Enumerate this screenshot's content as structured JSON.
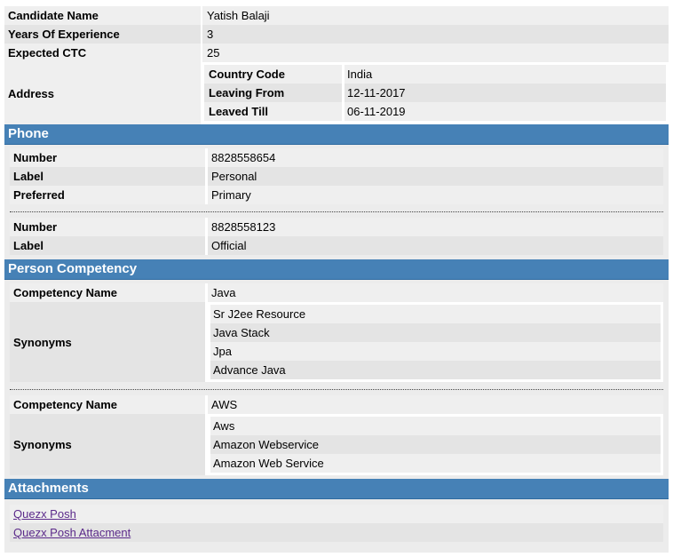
{
  "candidate": {
    "name_label": "Candidate Name",
    "name_value": "Yatish Balaji",
    "exp_label": "Years Of Experience",
    "exp_value": "3",
    "ctc_label": "Expected CTC",
    "ctc_value": "25",
    "address_label": "Address",
    "address": [
      {
        "label": "Country Code",
        "value": "India"
      },
      {
        "label": "Leaving From",
        "value": "12-11-2017"
      },
      {
        "label": "Leaved Till",
        "value": "06-11-2019"
      }
    ]
  },
  "phone": {
    "heading": "Phone",
    "entries": [
      {
        "number_label": "Number",
        "number": "8828558654",
        "label_label": "Label",
        "label": "Personal",
        "preferred_label": "Preferred",
        "preferred": "Primary"
      },
      {
        "number_label": "Number",
        "number": "8828558123",
        "label_label": "Label",
        "label": "Official"
      }
    ]
  },
  "competency": {
    "heading": "Person Competency",
    "entries": [
      {
        "name_label": "Competency Name",
        "name": "Java",
        "synonyms_label": "Synonyms",
        "synonyms": [
          "Sr J2ee Resource",
          "Java Stack",
          "Jpa",
          "Advance Java"
        ]
      },
      {
        "name_label": "Competency Name",
        "name": "AWS",
        "synonyms_label": "Synonyms",
        "synonyms": [
          "Aws",
          "Amazon Webservice",
          "Amazon Web Service"
        ]
      }
    ]
  },
  "attachments": {
    "heading": "Attachments",
    "links": [
      "Quezx Posh",
      "Quezx Posh Attacment"
    ]
  }
}
